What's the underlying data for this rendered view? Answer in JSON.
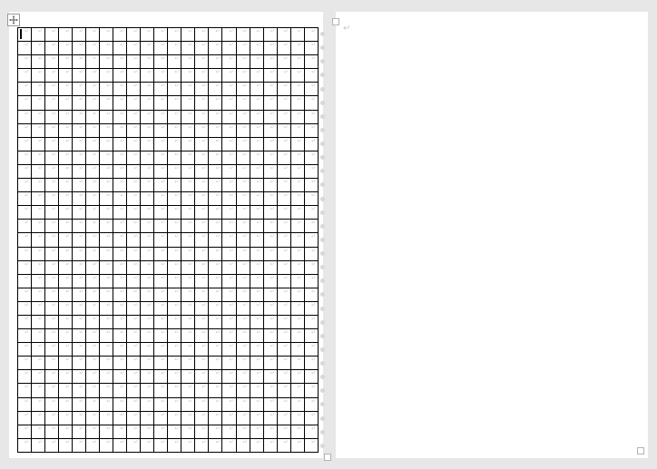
{
  "grid": {
    "columns": 22,
    "rows": 31
  },
  "right_page": {
    "paragraph_mark": "↵"
  },
  "colors": {
    "page_bg": "#ffffff",
    "workspace_bg": "#e7e7e7",
    "gridline": "#000000",
    "faded_mark": "#c9c9c9"
  }
}
